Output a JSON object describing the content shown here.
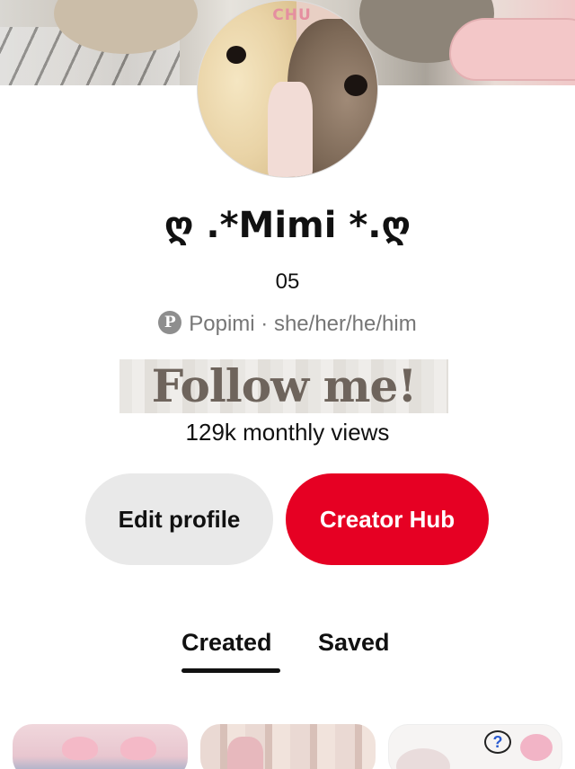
{
  "profile": {
    "avatar_sticker_text": "CHU",
    "display_name": "ღ .*Mimi *.ღ",
    "pin_count": "05",
    "handle_line": "Popimi · she/her/he/him",
    "banner_text": "Follow me!",
    "monthly_views": "129k monthly views"
  },
  "actions": {
    "edit_profile": "Edit profile",
    "creator_hub": "Creator Hub"
  },
  "tabs": [
    {
      "label": "Created",
      "active": true
    },
    {
      "label": "Saved",
      "active": false
    }
  ],
  "icons": {
    "pinterest": "pinterest-logo-icon",
    "help": "question-icon"
  },
  "colors": {
    "accent_red": "#e60023",
    "edit_button_bg": "#e9e9e9",
    "muted_text": "#767676"
  }
}
